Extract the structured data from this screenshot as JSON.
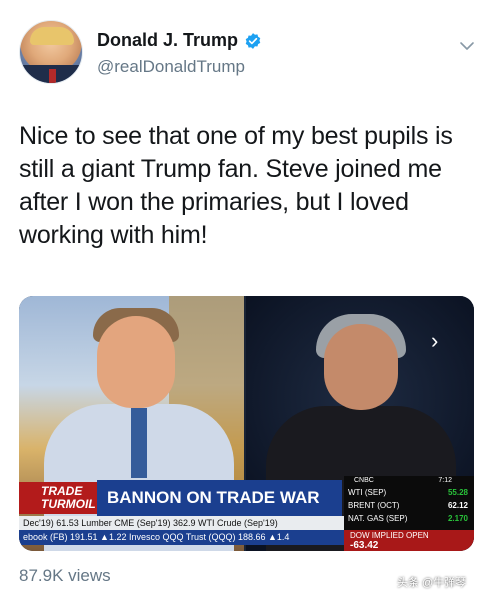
{
  "author": {
    "display_name": "Donald J. Trump",
    "handle": "@realDonaldTrump",
    "verified": true
  },
  "tweet": {
    "text": "Nice to see that one of my best pupils is still a giant Trump fan. Steve joined me after I won the primaries, but I loved working with him!",
    "views": "87.9K views"
  },
  "media": {
    "segment_badge": "TRADE TURMOIL",
    "headline": "BANNON ON TRADE WAR",
    "network": "CNBC",
    "time": "7:12",
    "quotes": [
      {
        "label": "WTI (SEP)",
        "value": "55.28"
      },
      {
        "label": "BRENT (OCT)",
        "value": "62.12"
      },
      {
        "label": "NAT. GAS (SEP)",
        "value": "2.170"
      }
    ],
    "ticker_top": "Dec'19) 61.53   Lumber CME (Sep'19) 362.9   WTI Crude (Sep'19)",
    "ticker_bottom": "ebook (FB) 191.51 ▲1.22   Invesco QQQ Trust (QQQ) 188.66 ▲1.4",
    "dow_label": "DOW IMPLIED OPEN",
    "dow_value": "-63.42"
  },
  "watermark": "头条 @牛弹琴",
  "colors": {
    "verified_blue": "#1da1f2",
    "headline_bar": "#1b3f8f",
    "badge_red": "#b31b1b",
    "text_primary": "#14171a",
    "text_secondary": "#657786"
  },
  "icons": {
    "verified": "verified-badge-icon",
    "menu": "chevron-down-icon",
    "gallery_next": "chevron-right-icon"
  }
}
